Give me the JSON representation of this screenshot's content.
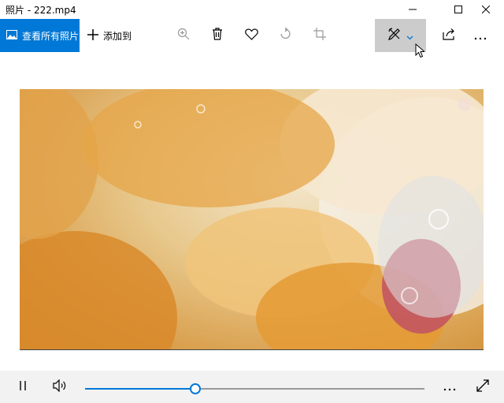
{
  "window": {
    "title": "照片 - 222.mp4",
    "controls": [
      "minimize-icon",
      "maximize-icon",
      "close-icon"
    ]
  },
  "toolbar": {
    "view_all_label": "查看所有照片",
    "add_to_label": "添加到",
    "icons": [
      "zoom-in-icon",
      "delete-icon",
      "heart-icon",
      "rotate-icon",
      "crop-icon",
      "draw-edit-icon",
      "share-icon",
      "more-icon"
    ],
    "accent_color": "#0078d7"
  },
  "player": {
    "state": "playing",
    "progress": 0.325,
    "controls": [
      "pause-icon",
      "volume-icon",
      "more-icon",
      "fullscreen-icon"
    ]
  }
}
